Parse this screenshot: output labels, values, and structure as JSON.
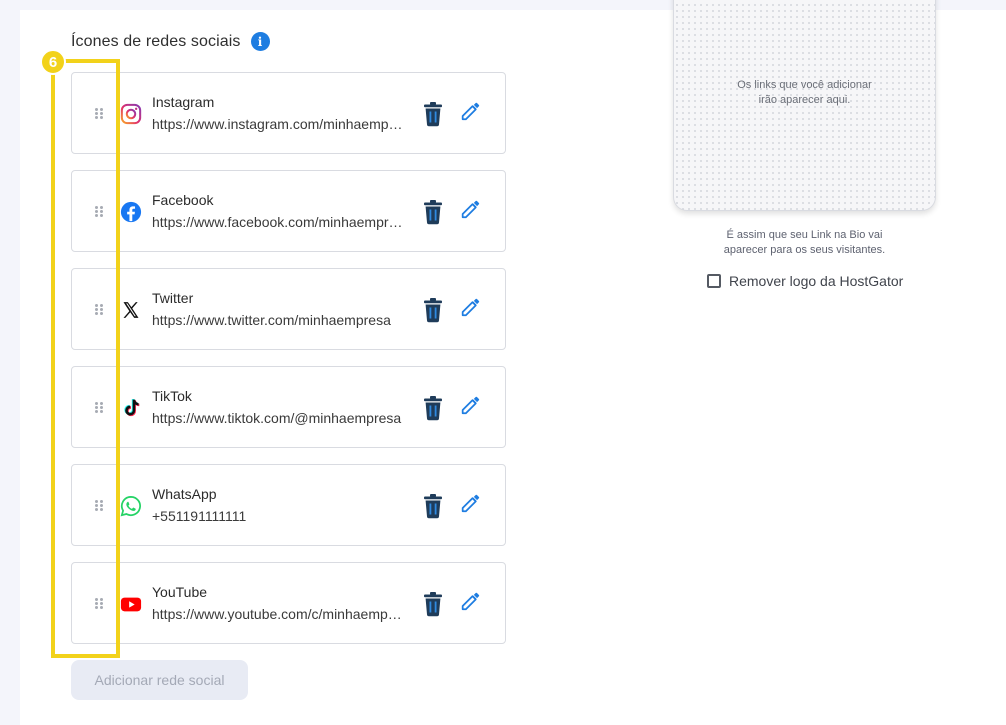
{
  "section": {
    "title": "Ícones de redes sociais",
    "info_icon": "info-icon",
    "step_badge": "6"
  },
  "social_items": [
    {
      "name": "Instagram",
      "url": "https://www.instagram.com/minhaempresa",
      "icon": "instagram-icon"
    },
    {
      "name": "Facebook",
      "url": "https://www.facebook.com/minhaempresa",
      "icon": "facebook-icon"
    },
    {
      "name": "Twitter",
      "url": "https://www.twitter.com/minhaempresa",
      "icon": "x-twitter-icon"
    },
    {
      "name": "TikTok",
      "url": "https://www.tiktok.com/@minhaempresa",
      "icon": "tiktok-icon"
    },
    {
      "name": "WhatsApp",
      "url": "+551191111111",
      "icon": "whatsapp-icon"
    },
    {
      "name": "YouTube",
      "url": "https://www.youtube.com/c/minhaempresa",
      "icon": "youtube-icon"
    }
  ],
  "add_button_label": "Adicionar rede social",
  "preview": {
    "empty_line1": "Os links que você adicionar",
    "empty_line2": "irão aparecer aqui.",
    "caption_line1": "É assim que seu Link na Bio vai",
    "caption_line2": "aparecer para os seus visitantes."
  },
  "remove_logo_label": "Remover logo da HostGator",
  "remove_logo_checked": false,
  "colors": {
    "accent_blue": "#1e7de1",
    "highlight_yellow": "#f2d21a",
    "trash_dark": "#1f3c5a"
  }
}
